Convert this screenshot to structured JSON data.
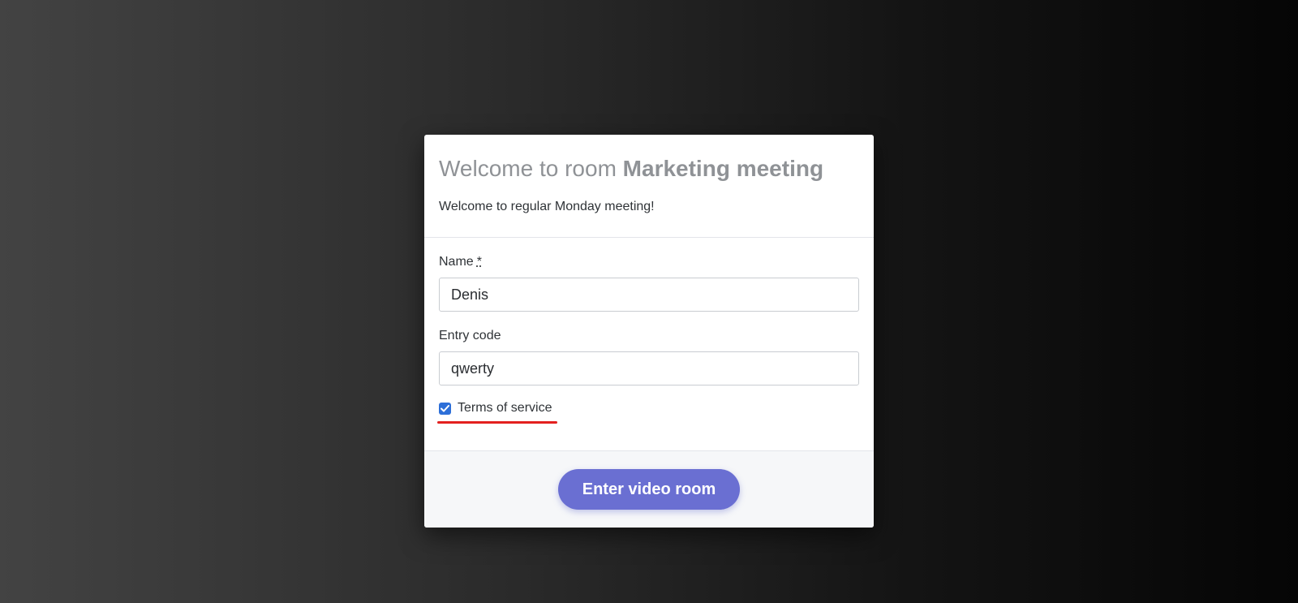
{
  "header": {
    "title_prefix": "Welcome to room",
    "room_name": "Marketing meeting",
    "description": "Welcome to regular Monday meeting!"
  },
  "form": {
    "name_label": "Name",
    "name_required_mark": "*",
    "name_value": "Denis",
    "entry_code_label": "Entry code",
    "entry_code_value": "qwerty",
    "terms_label": "Terms of service",
    "terms_checked": true
  },
  "footer": {
    "enter_button_label": "Enter video room"
  },
  "colors": {
    "accent": "#6a6fd2",
    "checkbox": "#2d6fd8",
    "highlight_underline": "#e3201f"
  }
}
